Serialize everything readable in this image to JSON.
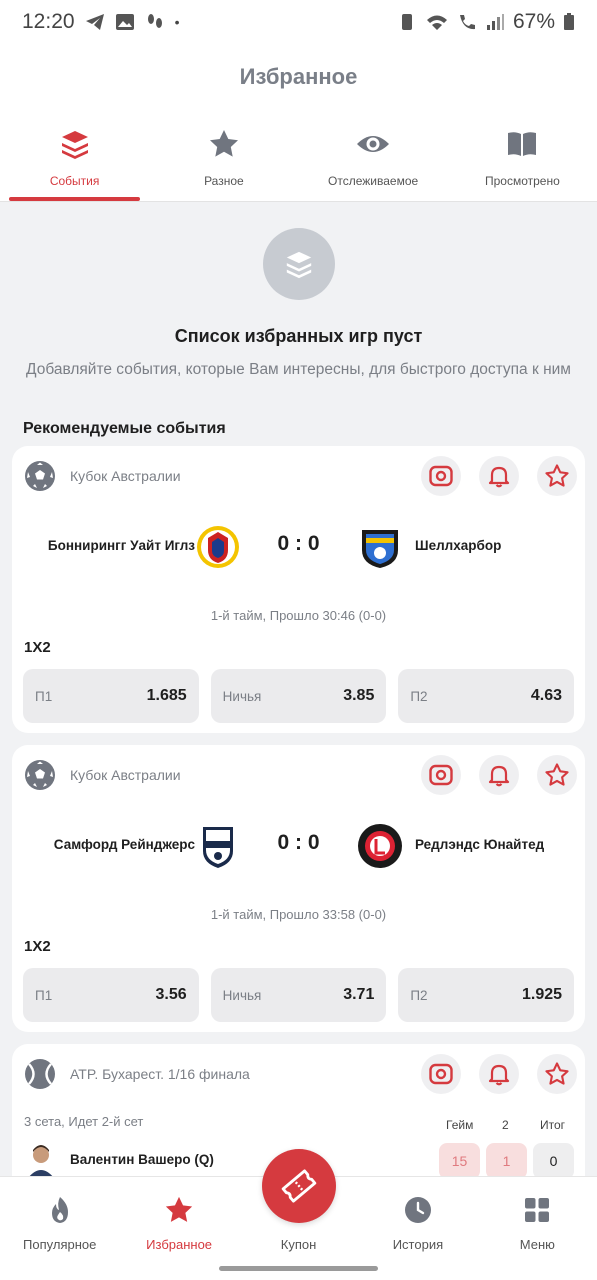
{
  "status_bar": {
    "time": "12:20",
    "battery": "67%"
  },
  "header": {
    "title": "Избранное"
  },
  "tabs": [
    {
      "label": "События",
      "icon": "layers-icon",
      "active": true
    },
    {
      "label": "Разное",
      "icon": "star-icon",
      "active": false
    },
    {
      "label": "Отслеживаемое",
      "icon": "eye-icon",
      "active": false
    },
    {
      "label": "Просмотрено",
      "icon": "book-icon",
      "active": false
    }
  ],
  "empty_state": {
    "title": "Список избранных игр пуст",
    "subtitle": "Добавляйте события, которые Вам интересны, для быстрого доступа к ним"
  },
  "recommended": {
    "title": "Рекомендуемые события",
    "matches": [
      {
        "league": "Кубок Австралии",
        "team1": "Боннирингг Уайт Иглз",
        "team2": "Шеллхарбор",
        "score": "0 : 0",
        "time": "1-й тайм, Прошло 30:46 (0-0)",
        "market": "1X2",
        "odds": [
          {
            "label": "П1",
            "value": "1.685"
          },
          {
            "label": "Ничья",
            "value": "3.85"
          },
          {
            "label": "П2",
            "value": "4.63"
          }
        ]
      },
      {
        "league": "Кубок Австралии",
        "team1": "Самфорд Рейнджерс",
        "team2": "Редлэндс Юнайтед",
        "score": "0 : 0",
        "time": "1-й тайм, Прошло 33:58 (0-0)",
        "market": "1X2",
        "odds": [
          {
            "label": "П1",
            "value": "3.56"
          },
          {
            "label": "Ничья",
            "value": "3.71"
          },
          {
            "label": "П2",
            "value": "1.925"
          }
        ]
      },
      {
        "league": "ATP. Бухарест. 1/16 финала",
        "status": "3 сета, Идет 2-й сет",
        "columns": [
          "Гейм",
          "2",
          "Итог"
        ],
        "player1": "Валентин Вашеро (Q)",
        "player1_scores": [
          "15",
          "1",
          "0"
        ]
      }
    ]
  },
  "bottom_nav": [
    {
      "label": "Популярное",
      "icon": "flame-icon",
      "active": false
    },
    {
      "label": "Избранное",
      "icon": "star-icon",
      "active": true
    },
    {
      "label": "Купон",
      "icon": "ticket-icon",
      "active": false
    },
    {
      "label": "История",
      "icon": "clock-icon",
      "active": false
    },
    {
      "label": "Меню",
      "icon": "grid-icon",
      "active": false
    }
  ],
  "colors": {
    "accent": "#d53a3f",
    "background": "#f1f2f4",
    "card": "#ffffff",
    "muted": "#7b7f86"
  }
}
